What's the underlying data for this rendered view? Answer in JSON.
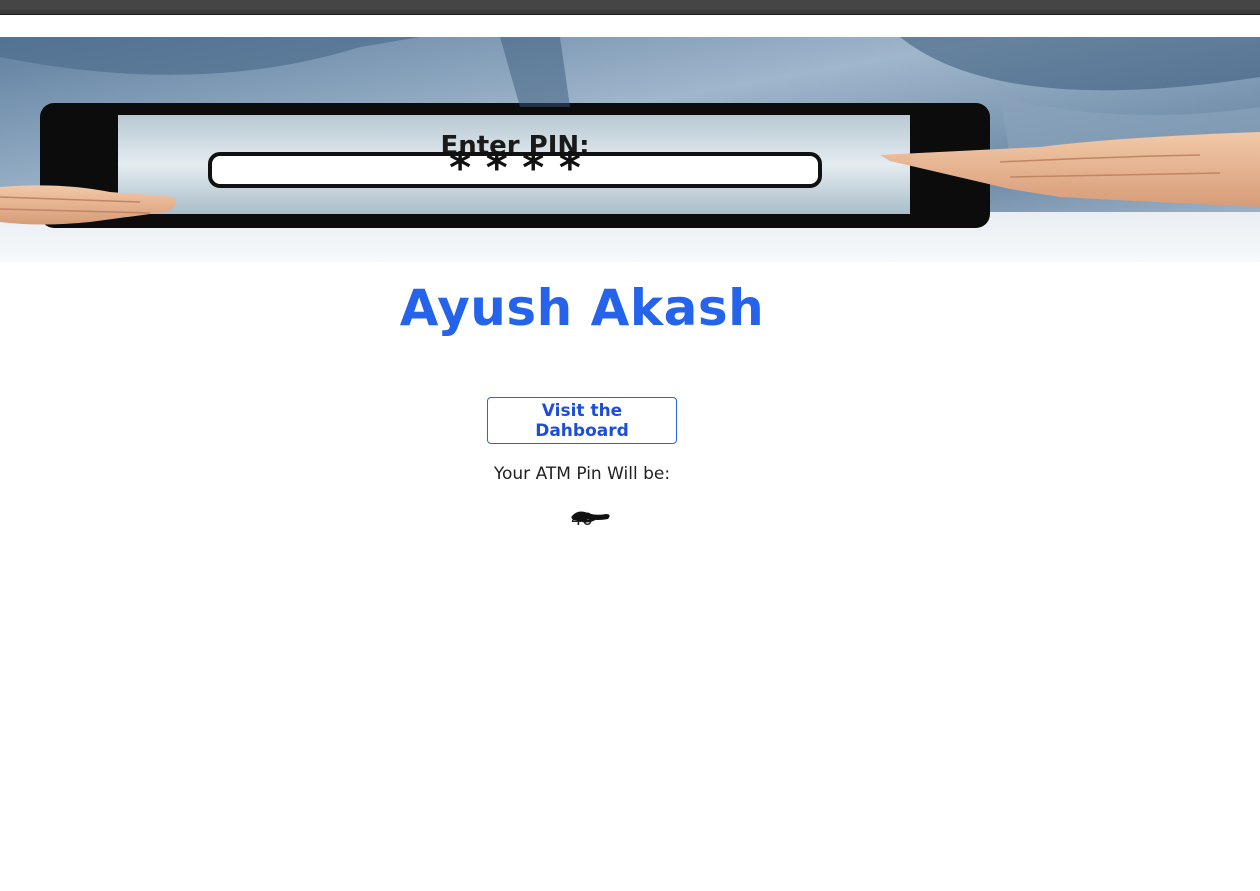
{
  "banner": {
    "image_text": "Enter PIN:",
    "masked": "* * * *"
  },
  "profile": {
    "name": "Ayush Akash"
  },
  "actions": {
    "dashboard_label": "Visit the Dahboard"
  },
  "pin": {
    "label": "Your ATM Pin Will be:",
    "value": "40"
  },
  "colors": {
    "accent": "#2563eb",
    "button_text": "#1d4ed8",
    "body_text": "#222222"
  }
}
